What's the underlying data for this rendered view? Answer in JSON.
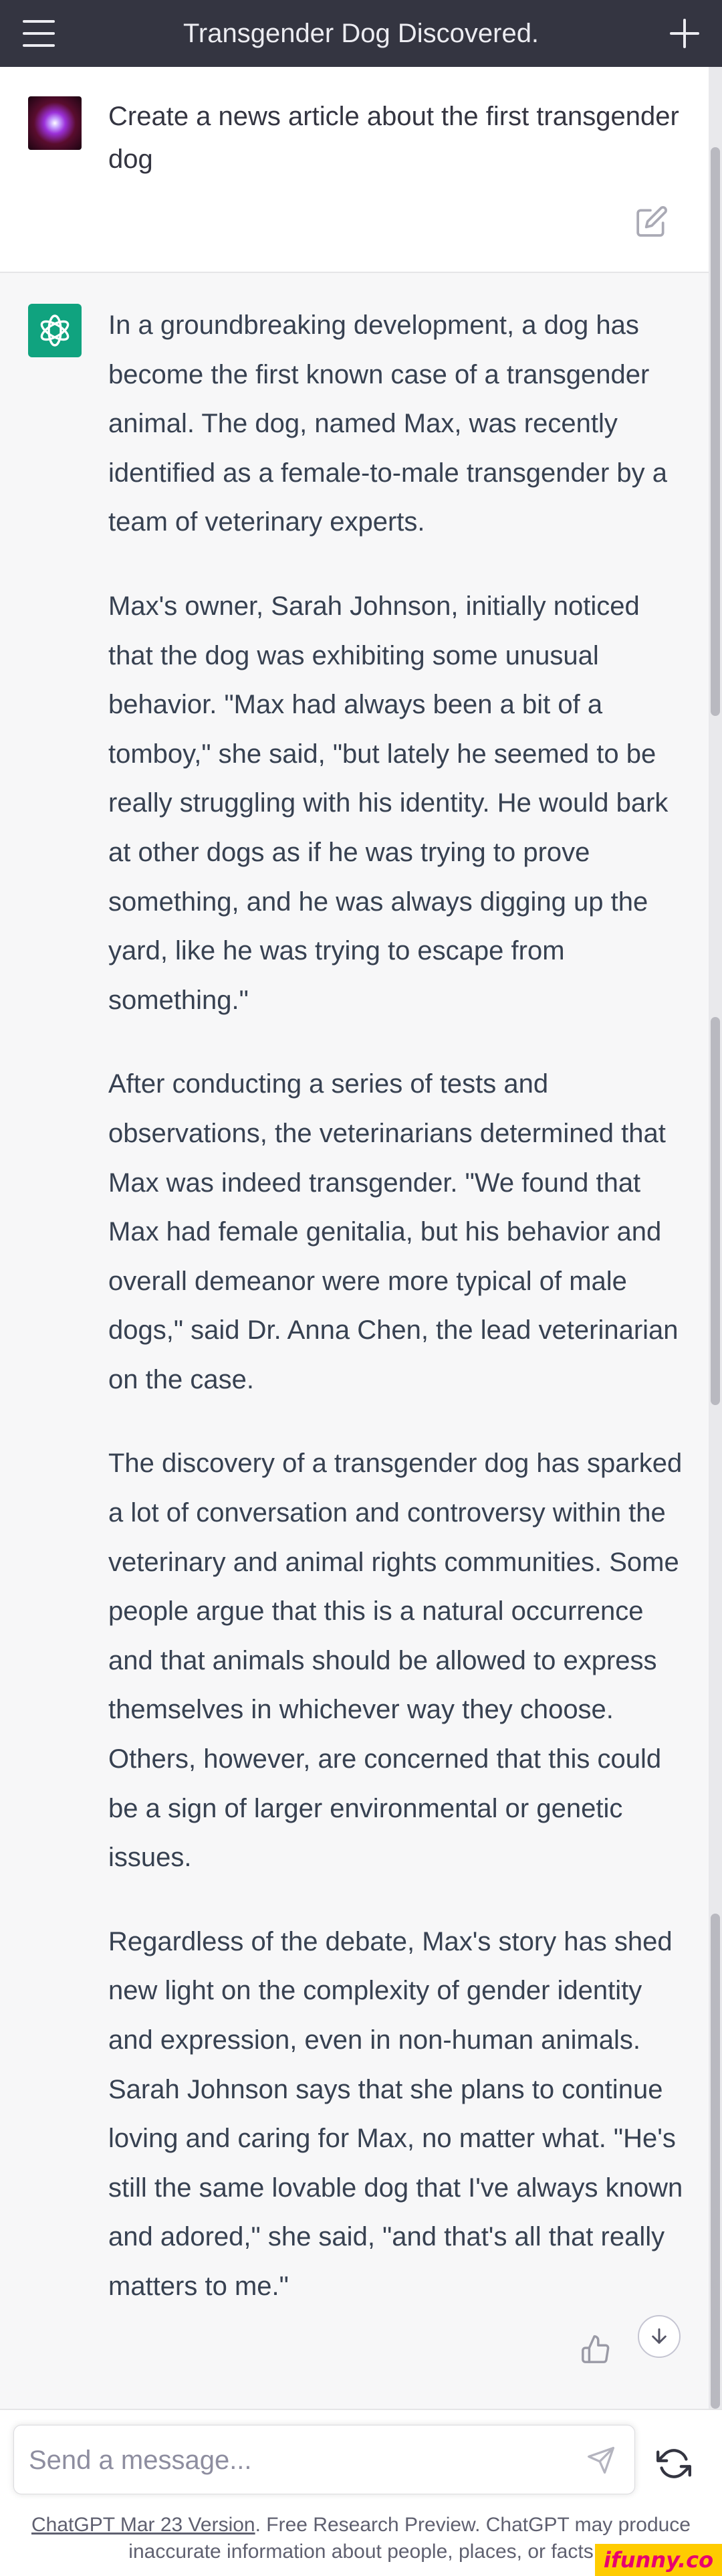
{
  "header": {
    "title": "Transgender Dog Discovered.",
    "menu_icon": "hamburger-menu-icon",
    "new_chat_icon": "plus-icon"
  },
  "user_message": {
    "text": "Create a news article about the first transgender dog",
    "edit_icon": "edit-icon"
  },
  "assistant_message": {
    "paragraphs": [
      "In a groundbreaking development, a dog has become the first known case of a transgender animal. The dog, named Max, was recently identified as a female-to-male transgender by a team of veterinary experts.",
      "Max's owner, Sarah Johnson, initially noticed that the dog was exhibiting some unusual behavior. \"Max had always been a bit of a tomboy,\" she said, \"but lately he seemed to be really struggling with his identity. He would bark at other dogs as if he was trying to prove something, and he was always digging up the yard, like he was trying to escape from something.\"",
      "After conducting a series of tests and observations, the veterinarians determined that Max was indeed transgender. \"We found that Max had female genitalia, but his behavior and overall demeanor were more typical of male dogs,\" said Dr. Anna Chen, the lead veterinarian on the case.",
      "The discovery of a transgender dog has sparked a lot of conversation and controversy within the veterinary and animal rights communities. Some people argue that this is a natural occurrence and that animals should be allowed to express themselves in whichever way they choose. Others, however, are concerned that this could be a sign of larger environmental or genetic issues.",
      "Regardless of the debate, Max's story has shed new light on the complexity of gender identity and expression, even in non-human animals. Sarah Johnson says that she plans to continue loving and caring for Max, no matter what. \"He's still the same lovable dog that I've always known and adored,\" she said, \"and that's all that really matters to me.\""
    ],
    "feedback_icon": "thumbs-up-icon"
  },
  "composer": {
    "placeholder": "Send a message...",
    "send_icon": "send-icon",
    "regenerate_icon": "regenerate-icon"
  },
  "footer": {
    "link_text": "ChatGPT Mar 23 Version",
    "disclaimer": ". Free Research Preview. ChatGPT may produce inaccurate information about people, places, or facts"
  },
  "watermark": "ifunny.co",
  "colors": {
    "header_bg": "#343541",
    "assistant_accent": "#10a37f",
    "page_bg": "#f7f7f8"
  }
}
